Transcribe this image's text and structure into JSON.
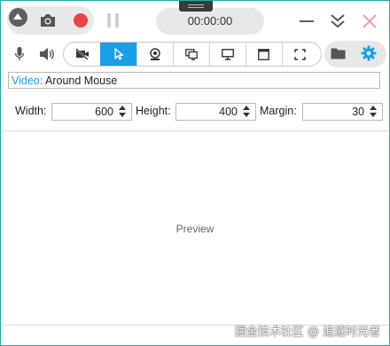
{
  "toolbar": {
    "timer": "00:00:00"
  },
  "modes": [
    {
      "name": "no-video",
      "icon": "video-off-icon"
    },
    {
      "name": "around-mouse",
      "icon": "cursor-icon",
      "active": true
    },
    {
      "name": "webcam",
      "icon": "webcam-icon"
    },
    {
      "name": "screen",
      "icon": "screens-icon"
    },
    {
      "name": "monitor",
      "icon": "monitor-icon"
    },
    {
      "name": "window",
      "icon": "window-icon"
    },
    {
      "name": "region",
      "icon": "region-icon"
    }
  ],
  "source": {
    "label": "Video:",
    "value": "Around Mouse"
  },
  "dimensions": {
    "width_label": "Width:",
    "width_value": "600",
    "height_label": "Height:",
    "height_value": "400",
    "margin_label": "Margin:",
    "margin_value": "30"
  },
  "preview": {
    "label": "Preview"
  },
  "watermark": "掘金技术社区 @ 追逐时光者",
  "colors": {
    "accent": "#1a9ee6",
    "record": "#e84545",
    "close": "#f2a0a0",
    "border": "#1fa9a5"
  }
}
